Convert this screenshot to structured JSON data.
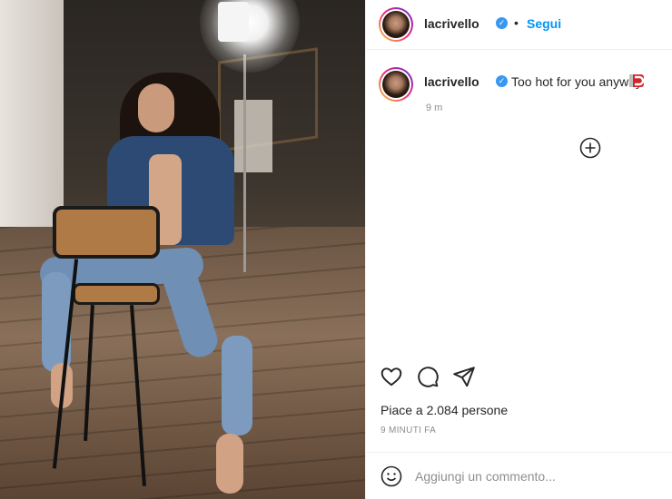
{
  "post": {
    "username": "lacrivello",
    "follow_label": "Segui",
    "separator": "•",
    "caption": "Too hot for you anyway",
    "caption_emoji": "magnet",
    "caption_time": "9 m",
    "likes_text": "Piace a 2.084 persone",
    "post_time": "9 MINUTI FA"
  },
  "comment": {
    "placeholder": "Aggiungi un commento..."
  },
  "icons": {
    "verified": "verified-badge-icon",
    "like": "heart-icon",
    "comment": "comment-bubble-icon",
    "share": "paper-plane-icon",
    "more_comments": "plus-circle-icon",
    "emoji": "smiley-icon"
  },
  "colors": {
    "accent": "#0095f6",
    "verified": "#3897f0",
    "text": "#262626",
    "muted": "#8e8e8e",
    "border": "#efefef"
  }
}
